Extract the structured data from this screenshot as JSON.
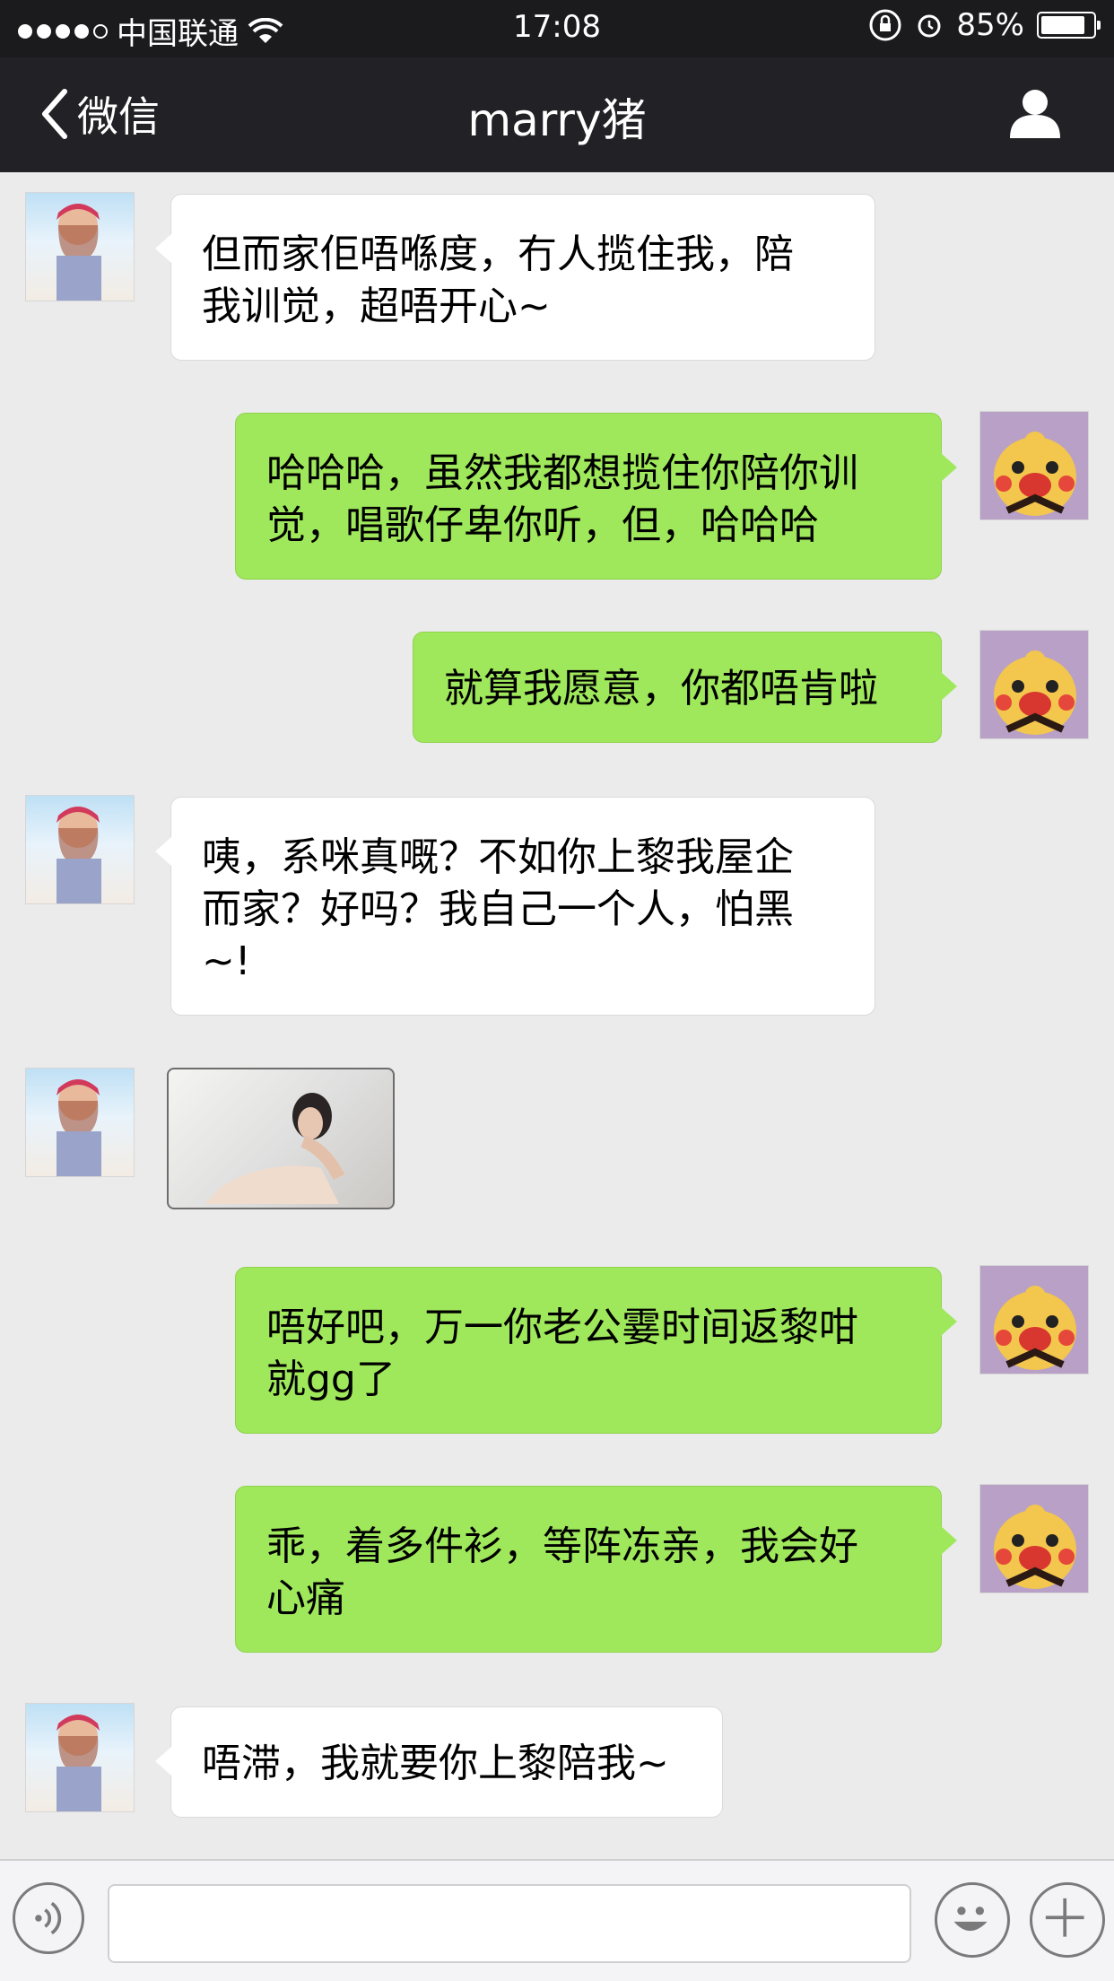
{
  "status_bar": {
    "carrier": "中国联通",
    "time": "17:08",
    "battery_text": "85%",
    "battery_level": 0.85,
    "signal_strength": "4 of 5",
    "icons": [
      "signal-icon",
      "wifi-icon",
      "rotation-lock-icon",
      "alarm-icon",
      "battery-icon"
    ]
  },
  "nav": {
    "back_label": "微信",
    "title": "marry猪",
    "profile_icon": "person-icon"
  },
  "messages": [
    {
      "from": "other",
      "type": "text",
      "lines": [
        "但而家佢唔喺度，冇人揽住我，陪",
        "我训觉，超唔开心~"
      ]
    },
    {
      "from": "me",
      "type": "text",
      "lines": [
        "哈哈哈，虽然我都想揽住你陪你训",
        "觉，唱歌仔卑你听，但，哈哈哈"
      ]
    },
    {
      "from": "me",
      "type": "text",
      "lines": [
        "就算我愿意，你都唔肯啦"
      ]
    },
    {
      "from": "other",
      "type": "text",
      "lines": [
        "咦，系咪真嘅？不如你上黎我屋企",
        "而家？好吗？我自己一个人，怕黑",
        "~!"
      ]
    },
    {
      "from": "other",
      "type": "image",
      "lines": []
    },
    {
      "from": "me",
      "type": "text",
      "lines": [
        "唔好吧，万一你老公霎时间返黎咁",
        "就gg了"
      ]
    },
    {
      "from": "me",
      "type": "text",
      "lines": [
        "乖，着多件衫，等阵冻亲，我会好",
        "心痛"
      ]
    },
    {
      "from": "other",
      "type": "text",
      "lines": [
        "唔滞，我就要你上黎陪我~"
      ]
    }
  ],
  "input_bar": {
    "voice_icon": "voice-icon",
    "emoji_icon": "emoji-icon",
    "plus_icon": "plus-icon",
    "text_value": ""
  },
  "colors": {
    "status_bg": "#1b1b1d",
    "nav_bg": "#222226",
    "chat_bg": "#ebebeb",
    "out_bubble": "#9fe85b",
    "in_bubble": "#ffffff"
  }
}
